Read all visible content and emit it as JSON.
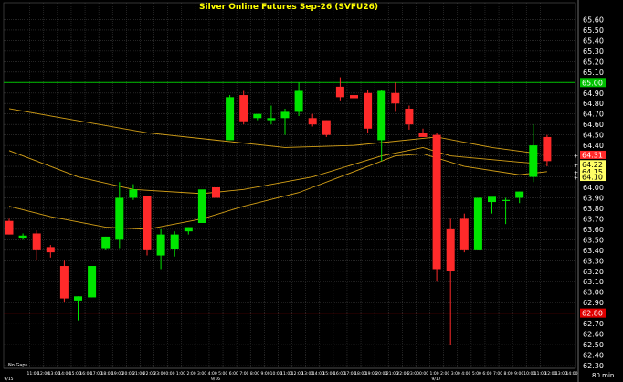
{
  "chart_data": {
    "type": "candlestick",
    "title": "Silver Online Futures  Sep-26  (SVFU26)",
    "timeframe_label": "80  min",
    "footnote": "No Gaps",
    "colors": {
      "background": "#000000",
      "grid": "#3a3a3a",
      "up": "#00e600",
      "down": "#ff2a2a",
      "title": "#ffff00",
      "axis_text": "#ffffff",
      "hline_upper": "#00c000",
      "hline_lower": "#e00000",
      "ma": "#d4a017"
    },
    "ylim": [
      62.3,
      65.7
    ],
    "yticks": [
      62.3,
      62.4,
      62.5,
      62.6,
      62.7,
      62.8,
      62.9,
      63.0,
      63.1,
      63.2,
      63.3,
      63.4,
      63.5,
      63.6,
      63.7,
      63.8,
      63.9,
      64.0,
      64.1,
      64.2,
      64.3,
      64.4,
      64.5,
      64.6,
      64.7,
      64.8,
      64.9,
      65.0,
      65.1,
      65.2,
      65.3,
      65.4,
      65.5,
      65.6
    ],
    "date_labels": [
      {
        "index": 0,
        "text": "9/15"
      },
      {
        "index": 15,
        "text": "9/16"
      },
      {
        "index": 31,
        "text": "9/17"
      }
    ],
    "time_labels": [
      "11:00",
      "12:00",
      "13:00",
      "14:00",
      "15:00",
      "16:00",
      "17:00",
      "18:00",
      "19:00",
      "20:00",
      "21:00",
      "22:00",
      "23:00",
      "0:00",
      "1:00",
      "2:00",
      "3:00",
      "4:00",
      "5:00",
      "6:00",
      "7:00",
      "8:00",
      "9:00",
      "10:00",
      "11:00",
      "12:00",
      "13:00",
      "14:00",
      "15:00",
      "16:00",
      "17:00",
      "18:00",
      "19:00",
      "20:00",
      "21:00",
      "22:00",
      "23:00",
      "0:00",
      "1:00",
      "2:00",
      "3:00",
      "4:00",
      "5:00",
      "6:00",
      "7:00",
      "8:00",
      "9:00",
      "10:00",
      "11:00",
      "12:00",
      "13:00",
      "14:00"
    ],
    "h_lines": [
      {
        "value": 65.0,
        "label": "65.00",
        "role": "upper"
      },
      {
        "value": 62.8,
        "label": "62.80",
        "role": "lower"
      }
    ],
    "price_tags": [
      {
        "value": 64.31,
        "label": "64.31",
        "kind": "down"
      },
      {
        "value": 64.22,
        "label": "64.22",
        "kind": "ma"
      },
      {
        "value": 64.15,
        "label": "64.15",
        "kind": "ma"
      },
      {
        "value": 64.1,
        "label": "64.10",
        "kind": "ma"
      }
    ],
    "candles": [
      {
        "o": 63.68,
        "h": 63.7,
        "l": 63.55,
        "c": 63.55
      },
      {
        "o": 63.52,
        "h": 63.56,
        "l": 63.5,
        "c": 63.54
      },
      {
        "o": 63.56,
        "h": 63.59,
        "l": 63.3,
        "c": 63.4
      },
      {
        "o": 63.43,
        "h": 63.45,
        "l": 63.33,
        "c": 63.38
      },
      {
        "o": 63.25,
        "h": 63.3,
        "l": 62.9,
        "c": 62.94
      },
      {
        "o": 62.92,
        "h": 62.96,
        "l": 62.73,
        "c": 62.96
      },
      {
        "o": 62.95,
        "h": 63.25,
        "l": 62.95,
        "c": 63.25
      },
      {
        "o": 63.42,
        "h": 63.53,
        "l": 63.4,
        "c": 63.53
      },
      {
        "o": 63.5,
        "h": 64.05,
        "l": 63.42,
        "c": 63.9
      },
      {
        "o": 63.9,
        "h": 64.03,
        "l": 63.88,
        "c": 63.98
      },
      {
        "o": 63.92,
        "h": 63.92,
        "l": 63.35,
        "c": 63.4
      },
      {
        "o": 63.35,
        "h": 63.6,
        "l": 63.22,
        "c": 63.55
      },
      {
        "o": 63.41,
        "h": 63.58,
        "l": 63.34,
        "c": 63.55
      },
      {
        "o": 63.58,
        "h": 63.62,
        "l": 63.55,
        "c": 63.62
      },
      {
        "o": 63.66,
        "h": 63.9,
        "l": 63.66,
        "c": 63.98
      },
      {
        "o": 64.0,
        "h": 64.05,
        "l": 63.88,
        "c": 63.9
      },
      {
        "o": 64.45,
        "h": 64.88,
        "l": 64.45,
        "c": 64.86
      },
      {
        "o": 64.88,
        "h": 64.92,
        "l": 64.6,
        "c": 64.63
      },
      {
        "o": 64.66,
        "h": 64.7,
        "l": 64.64,
        "c": 64.7
      },
      {
        "o": 64.64,
        "h": 64.78,
        "l": 64.6,
        "c": 64.66
      },
      {
        "o": 64.66,
        "h": 64.75,
        "l": 64.5,
        "c": 64.72
      },
      {
        "o": 64.72,
        "h": 65.0,
        "l": 64.68,
        "c": 64.92
      },
      {
        "o": 64.66,
        "h": 64.7,
        "l": 64.58,
        "c": 64.6
      },
      {
        "o": 64.64,
        "h": 64.64,
        "l": 64.48,
        "c": 64.5
      },
      {
        "o": 64.96,
        "h": 65.05,
        "l": 64.83,
        "c": 64.86
      },
      {
        "o": 64.88,
        "h": 64.93,
        "l": 64.83,
        "c": 64.85
      },
      {
        "o": 64.9,
        "h": 64.93,
        "l": 64.52,
        "c": 64.56
      },
      {
        "o": 64.45,
        "h": 64.93,
        "l": 64.25,
        "c": 64.92
      },
      {
        "o": 64.9,
        "h": 65.0,
        "l": 64.72,
        "c": 64.8
      },
      {
        "o": 64.75,
        "h": 64.78,
        "l": 64.55,
        "c": 64.6
      },
      {
        "o": 64.52,
        "h": 64.56,
        "l": 64.48,
        "c": 64.48
      },
      {
        "o": 64.5,
        "h": 64.52,
        "l": 63.1,
        "c": 63.22
      },
      {
        "o": 63.6,
        "h": 63.7,
        "l": 62.5,
        "c": 63.2
      },
      {
        "o": 63.7,
        "h": 63.75,
        "l": 63.38,
        "c": 63.4
      },
      {
        "o": 63.4,
        "h": 63.9,
        "l": 63.4,
        "c": 63.9
      },
      {
        "o": 63.86,
        "h": 63.9,
        "l": 63.75,
        "c": 63.91
      },
      {
        "o": 63.88,
        "h": 63.9,
        "l": 63.65,
        "c": 63.88
      },
      {
        "o": 63.9,
        "h": 63.96,
        "l": 63.85,
        "c": 63.96
      },
      {
        "o": 64.1,
        "h": 64.6,
        "l": 64.05,
        "c": 64.4
      },
      {
        "o": 64.48,
        "h": 64.5,
        "l": 64.2,
        "c": 64.25
      }
    ],
    "ma_series": [
      {
        "name": "",
        "points": [
          [
            0,
            64.75
          ],
          [
            10,
            64.52
          ],
          [
            15,
            64.45
          ],
          [
            20,
            64.38
          ],
          [
            25,
            64.4
          ],
          [
            31,
            64.48
          ],
          [
            35,
            64.38
          ],
          [
            39,
            64.31
          ]
        ]
      },
      {
        "name": "",
        "points": [
          [
            0,
            64.35
          ],
          [
            5,
            64.1
          ],
          [
            9,
            63.98
          ],
          [
            14,
            63.94
          ],
          [
            17,
            63.98
          ],
          [
            22,
            64.1
          ],
          [
            27,
            64.3
          ],
          [
            30,
            64.38
          ],
          [
            32,
            64.3
          ],
          [
            37,
            64.24
          ],
          [
            39,
            64.22
          ]
        ]
      },
      {
        "name": "",
        "points": [
          [
            0,
            63.82
          ],
          [
            3,
            63.72
          ],
          [
            7,
            63.62
          ],
          [
            10,
            63.6
          ],
          [
            14,
            63.7
          ],
          [
            17,
            63.82
          ],
          [
            21,
            63.95
          ],
          [
            25,
            64.15
          ],
          [
            28,
            64.3
          ],
          [
            30,
            64.32
          ],
          [
            33,
            64.2
          ],
          [
            37,
            64.12
          ],
          [
            39,
            64.15
          ]
        ]
      }
    ]
  }
}
